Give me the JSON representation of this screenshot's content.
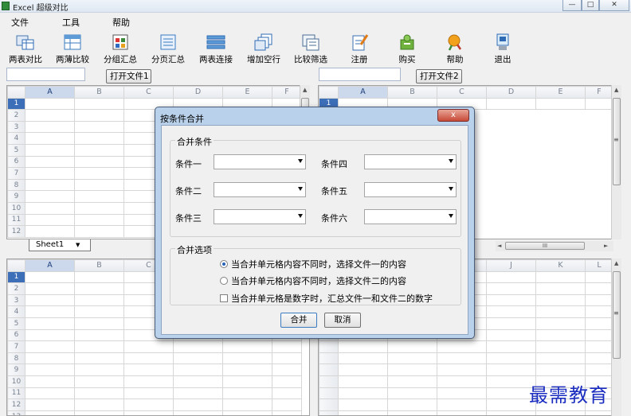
{
  "window": {
    "title": "Excel 超级对比",
    "min_glyph": "—",
    "max_glyph": "□",
    "close_glyph": "✕"
  },
  "menu": [
    "文件",
    "工具",
    "帮助"
  ],
  "toolbar": [
    {
      "label": "两表对比",
      "icon": "compare-tables-icon"
    },
    {
      "label": "两薄比较",
      "icon": "compare-books-icon"
    },
    {
      "label": "分组汇总",
      "icon": "group-summary-icon"
    },
    {
      "label": "分页汇总",
      "icon": "page-summary-icon"
    },
    {
      "label": "两表连接",
      "icon": "join-tables-icon"
    },
    {
      "label": "增加空行",
      "icon": "add-rows-icon"
    },
    {
      "label": "比较筛选",
      "icon": "filter-compare-icon"
    },
    {
      "label": "注册",
      "icon": "register-icon"
    },
    {
      "label": "购买",
      "icon": "buy-icon"
    },
    {
      "label": "帮助",
      "icon": "help-icon"
    },
    {
      "label": "退出",
      "icon": "exit-icon"
    }
  ],
  "file1": {
    "path_value": "",
    "open_label": "打开文件1"
  },
  "file2": {
    "path_value": "",
    "open_label": "打开文件2"
  },
  "grid_left_top": {
    "columns": [
      "A",
      "B",
      "C",
      "D",
      "E",
      "F"
    ],
    "rows": [
      "1",
      "2",
      "3",
      "4",
      "5",
      "6",
      "7",
      "8",
      "9",
      "10",
      "11",
      "12"
    ]
  },
  "grid_right_top": {
    "columns": [
      "A",
      "B",
      "C",
      "D",
      "E",
      "F"
    ],
    "rows": [
      "1"
    ]
  },
  "grid_left_bottom": {
    "columns": [
      "A",
      "B",
      "C"
    ],
    "rows": [
      "1",
      "2",
      "3",
      "4",
      "5",
      "6",
      "7",
      "8",
      "9",
      "10",
      "11",
      "12",
      "13"
    ]
  },
  "grid_right_bottom": {
    "columns": [
      "J",
      "K",
      "L"
    ]
  },
  "sheet_tab": "Sheet1",
  "scroll_glyphs": {
    "up": "▲",
    "down": "▼",
    "left": "◄",
    "right": "►",
    "grip": "≡",
    "hgrip": "III"
  },
  "dialog": {
    "title": "按条件合并",
    "close_glyph": "x",
    "conditions_group": "合并条件",
    "conditions": [
      {
        "label": "条件一",
        "value": ""
      },
      {
        "label": "条件四",
        "value": ""
      },
      {
        "label": "条件二",
        "value": ""
      },
      {
        "label": "条件五",
        "value": ""
      },
      {
        "label": "条件三",
        "value": ""
      },
      {
        "label": "条件六",
        "value": ""
      }
    ],
    "options_group": "合并选项",
    "options": [
      {
        "label": "当合并单元格内容不同时，选择文件一的内容",
        "kind": "radio",
        "checked": true
      },
      {
        "label": "当合并单元格内容不同时，选择文件二的内容",
        "kind": "radio",
        "checked": false
      },
      {
        "label": "当合并单元格是数字时，汇总文件一和文件二的数字",
        "kind": "checkbox",
        "checked": false
      }
    ],
    "merge_label": "合并",
    "cancel_label": "取消"
  },
  "watermark": "最需教育",
  "colors": {
    "selection": "#3d6eb8",
    "dialog_frame": "#b9d1ea",
    "watermark": "#1a2dc0"
  }
}
